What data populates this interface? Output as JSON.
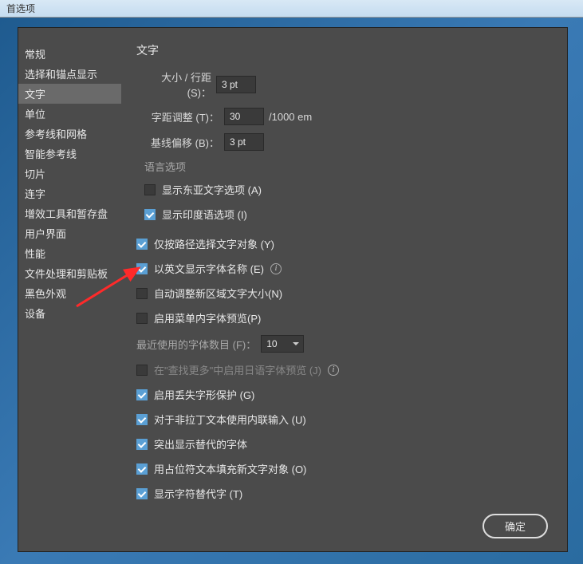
{
  "titlebar": {
    "title": "首选项"
  },
  "sidebar": {
    "items": [
      {
        "label": "常规"
      },
      {
        "label": "选择和锚点显示"
      },
      {
        "label": "文字"
      },
      {
        "label": "单位"
      },
      {
        "label": "参考线和网格"
      },
      {
        "label": "智能参考线"
      },
      {
        "label": "切片"
      },
      {
        "label": "连字"
      },
      {
        "label": "增效工具和暂存盘"
      },
      {
        "label": "用户界面"
      },
      {
        "label": "性能"
      },
      {
        "label": "文件处理和剪贴板"
      },
      {
        "label": "黑色外观"
      },
      {
        "label": "设备"
      }
    ],
    "selected_index": 2
  },
  "content": {
    "title": "文字",
    "fields": {
      "size_leading": {
        "label": "大小 / 行距 (S)：",
        "value": "3 pt"
      },
      "tracking": {
        "label": "字距调整 (T)：",
        "value": "30",
        "unit": "/1000 em"
      },
      "baseline_shift": {
        "label": "基线偏移 (B)：",
        "value": "3 pt"
      }
    },
    "language_section": {
      "title": "语言选项",
      "east_asian": {
        "label": "显示东亚文字选项 (A)",
        "checked": false
      },
      "indic": {
        "label": "显示印度语选项 (I)",
        "checked": true
      }
    },
    "options": {
      "select_by_path": {
        "label": "仅按路径选择文字对象 (Y)",
        "checked": true
      },
      "english_fontnames": {
        "label": "以英文显示字体名称 (E)",
        "checked": true,
        "info": true
      },
      "auto_size_area": {
        "label": "自动调整新区域文字大小(N)",
        "checked": false
      },
      "font_preview_menu": {
        "label": "启用菜单内字体预览(P)",
        "checked": false
      },
      "recent_fonts": {
        "label": "最近使用的字体数目 (F)：",
        "value": "10"
      },
      "japanese_preview": {
        "label": "在\"查找更多\"中启用日语字体预览 (J)",
        "checked": false,
        "info": true
      },
      "missing_glyph": {
        "label": "启用丢失字形保护 (G)",
        "checked": true
      },
      "inline_input": {
        "label": "对于非拉丁文本使用内联输入 (U)",
        "checked": true
      },
      "highlight_alt": {
        "label": "突出显示替代的字体",
        "checked": true
      },
      "placeholder_fill": {
        "label": "用占位符文本填充新文字对象 (O)",
        "checked": true
      },
      "show_char_alt": {
        "label": "显示字符替代字 (T)",
        "checked": true
      }
    }
  },
  "buttons": {
    "ok": "确定"
  }
}
